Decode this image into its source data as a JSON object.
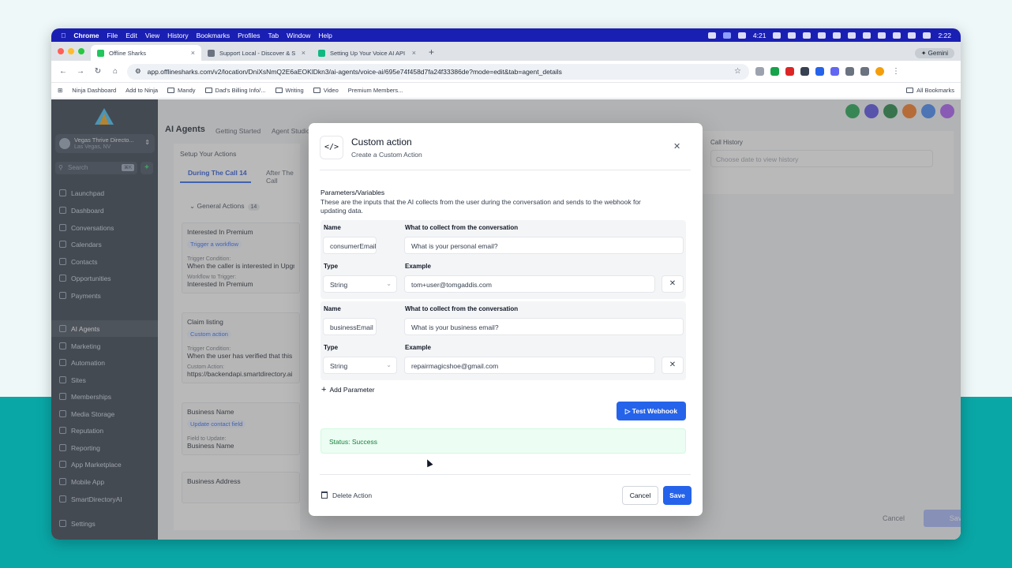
{
  "menubar": {
    "app": "Chrome",
    "items": [
      "File",
      "Edit",
      "View",
      "History",
      "Bookmarks",
      "Profiles",
      "Tab",
      "Window",
      "Help"
    ],
    "timer": "4:21",
    "clock": "2:22"
  },
  "tabs": [
    {
      "title": "Offline Sharks",
      "active": true
    },
    {
      "title": "Support Local - Discover & S",
      "active": false
    },
    {
      "title": "Setting Up Your Voice AI API",
      "active": false
    }
  ],
  "gemini_label": "Gemini",
  "address": "app.offlinesharks.com/v2/location/DniXsNmQ2E6aEOKlDkn3/ai-agents/voice-ai/695e74f458d7fa24f33386de?mode=edit&tab=agent_details",
  "bookmarks": {
    "items": [
      "Ninja Dashboard",
      "Add to Ninja",
      "Mandy",
      "Dad's Billing Info/...",
      "Writing",
      "Video",
      "Premium Members..."
    ],
    "all": "All Bookmarks"
  },
  "sidebar": {
    "location_name": "Vegas Thrive Directo...",
    "location_sub": "Las Vegas, NV",
    "search_placeholder": "Search",
    "search_kbd": "⌘K",
    "items": [
      "Launchpad",
      "Dashboard",
      "Conversations",
      "Calendars",
      "Contacts",
      "Opportunities",
      "Payments",
      "AI Agents",
      "Marketing",
      "Automation",
      "Sites",
      "Memberships",
      "Media Storage",
      "Reputation",
      "Reporting",
      "App Marketplace",
      "Mobile App",
      "SmartDirectoryAI",
      "Settings"
    ],
    "active_item": "AI Agents"
  },
  "main": {
    "title": "AI Agents",
    "tabs": [
      "Getting Started",
      "Agent Studio"
    ],
    "setup": "Setup Your Actions",
    "ptabs": {
      "during": "During The Call",
      "during_count": "14",
      "after": "After The Call"
    },
    "general": "General Actions",
    "general_count": "14",
    "cards": [
      {
        "title": "Interested In Premium",
        "pill": "Trigger a workflow",
        "l1": "Trigger Condition:",
        "v1": "When the caller is interested in Upgrading",
        "l2": "Workflow to Trigger:",
        "v2": "Interested In Premium"
      },
      {
        "title": "Claim listing",
        "pill": "Custom action",
        "l1": "Trigger Condition:",
        "v1": "When the user has verified that this is their",
        "l2": "Custom Action:",
        "v2": "https://backendapi.smartdirectory.ai"
      },
      {
        "title": "Business Name",
        "pill": "Update contact field",
        "l1": "Field to Update:",
        "v1": "Business Name"
      },
      {
        "title": "Business Address"
      }
    ],
    "call_history": "Call History",
    "call_history_placeholder": "Choose date to view history",
    "cancel": "Cancel",
    "save": "Save"
  },
  "modal": {
    "icon": "</>",
    "title": "Custom action",
    "subtitle": "Create a Custom Action",
    "section": "Parameters/Variables",
    "description": "These are the inputs that the AI collects from the user during the conversation and sends to the webhook for updating data.",
    "labels": {
      "name": "Name",
      "collect": "What to collect from the conversation",
      "type": "Type",
      "example": "Example"
    },
    "params": [
      {
        "name": "consumerEmail",
        "collect": "What is your personal email?",
        "type": "String",
        "example": "tom+user@tomgaddis.com"
      },
      {
        "name": "businessEmail",
        "collect": "What is your business email?",
        "type": "String",
        "example": "repairmagicshoe@gmail.com"
      }
    ],
    "add_parameter": "Add Parameter",
    "test_webhook": "Test Webhook",
    "status": "Status: Success",
    "delete_action": "Delete Action",
    "cancel": "Cancel",
    "save": "Save"
  },
  "colors": {
    "primary": "#2563eb",
    "sidebar": "#2b3544",
    "success_bg": "#ecfdf3",
    "success_text": "#15803d"
  }
}
